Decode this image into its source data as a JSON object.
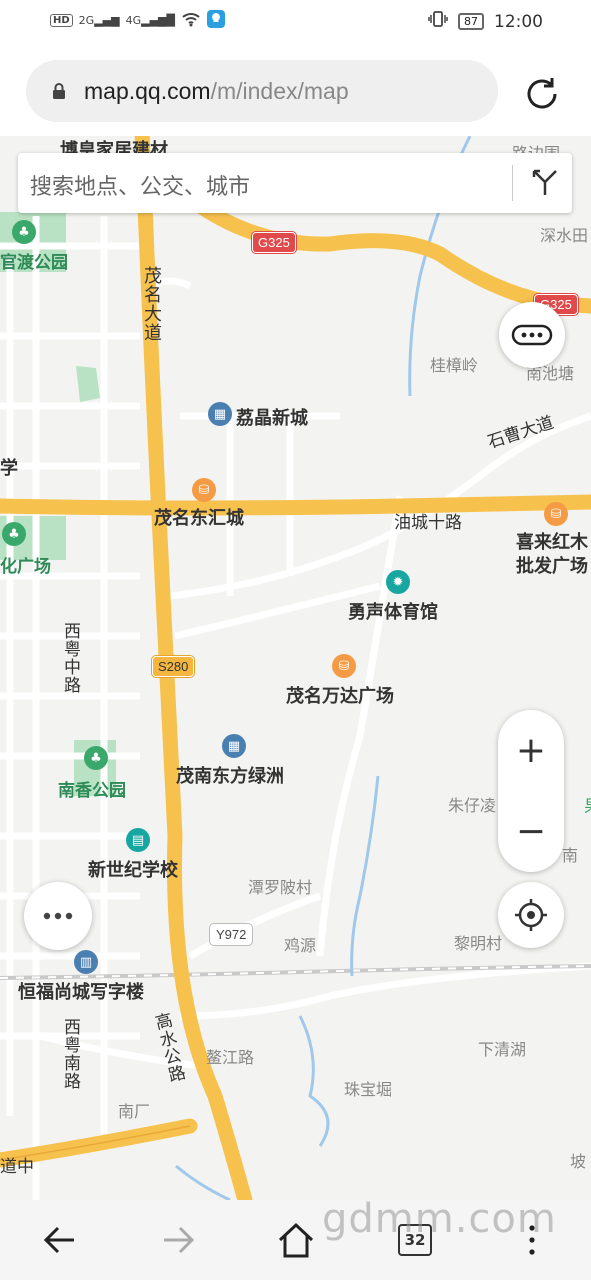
{
  "status_bar": {
    "left_chips": [
      "HD",
      "2G",
      "4G"
    ],
    "battery": "87",
    "time": "12:00"
  },
  "browser": {
    "url_domain": "map.qq.com",
    "url_path": "/m/index/map"
  },
  "search": {
    "placeholder": "搜索地点、公交、城市"
  },
  "map_labels": {
    "top_label": "博皇家居建材",
    "lubian": "路边围",
    "shenshui": "深水田",
    "guandu_park": "官渡公园",
    "maoming_ave": "茂名大道",
    "guizhangling": "桂樟岭",
    "nanchitang": "南池塘",
    "lijing": "荔晶新城",
    "shicao": "石曹大道",
    "xue": "学",
    "donghui": "茂名东汇城",
    "youcheng": "油城十路",
    "xilai_1": "喜来红木",
    "xilai_2": "批发广场",
    "hua_square": "化广场",
    "yongsheng": "勇声体育馆",
    "xiyue_1": "西粤中路",
    "wanda": "茂名万达广场",
    "nanxiang": "南香公园",
    "maonan": "茂南东方绿洲",
    "zhuzi": "朱仔凌",
    "nan": "南",
    "xinshiji": "新世纪学校",
    "tanluoling": "潭罗陂村",
    "jiyuan": "鸡源",
    "liming": "黎明村",
    "hengfu": "恒福尚城写字楼",
    "xiyue_2": "西粤南路",
    "gaoshui": "高水公路",
    "aojiang": "鳌江路",
    "xiaqinghu": "下清湖",
    "zhubaoju": "珠宝堀",
    "nanchang": "南厂",
    "daozhong": "道中",
    "po": "坡",
    "bao": "果"
  },
  "shields": {
    "g325_a": "G325",
    "g325_b": "G325",
    "s280": "S280",
    "y972": "Y972"
  },
  "bottom_nav": {
    "tab_count": "32",
    "watermark": "gdmm.com"
  },
  "colors": {
    "highway": "#f7c14d",
    "map_bg": "#f3f4f1",
    "water": "#9fc8ea",
    "park": "#b9e2c4"
  }
}
